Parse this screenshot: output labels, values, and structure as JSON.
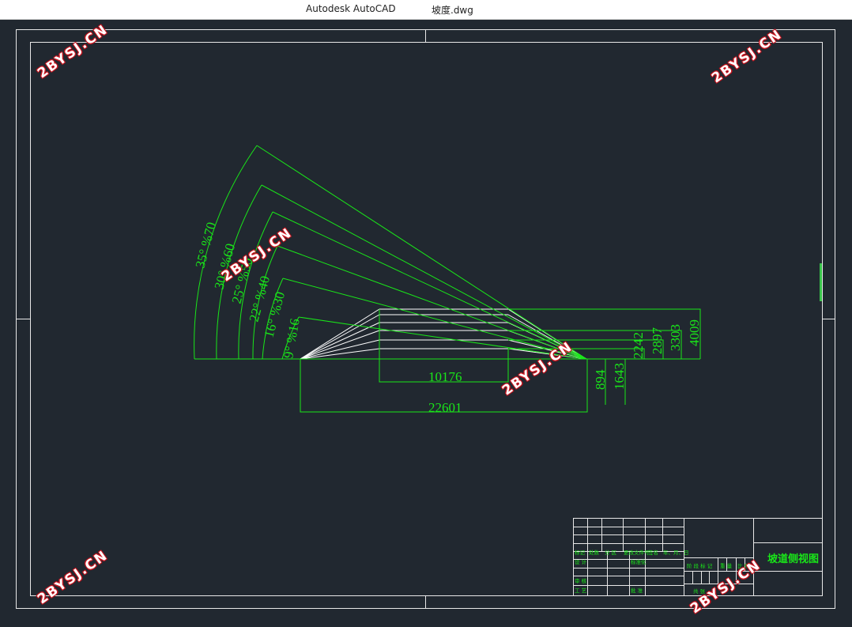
{
  "window": {
    "app_title": "Autodesk AutoCAD",
    "file_name": "坡度.dwg"
  },
  "colors": {
    "background": "#212830",
    "frame": "#e8e8e8",
    "geometry": "#19e619",
    "white_lines": "#ffffff",
    "watermark": "#c8141e"
  },
  "angles": [
    "35° %70",
    "30° %60",
    "25° %50",
    "22° %40",
    "16° %30",
    "9° %16"
  ],
  "dimensions": {
    "inner": "10176",
    "total": "22601",
    "verticals_below": [
      "894",
      "1643"
    ],
    "verticals_right": [
      "2242",
      "2897",
      "3303",
      "4009"
    ]
  },
  "title_block": {
    "drawing_title": "坡道侧视图",
    "col_labels": [
      "标记",
      "处数",
      "分 区",
      "更改文件号",
      "签名",
      "年、月、日"
    ],
    "row_design": "设 计",
    "row_standard": "标准化",
    "row_review": "审 核",
    "row_craft": "工 艺",
    "row_approve": "批 准",
    "stage": "阶 段 标 记",
    "weight": "重 量",
    "scale": "比 例",
    "sheets": "共   张"
  },
  "watermark": "2BYSJ.CN"
}
